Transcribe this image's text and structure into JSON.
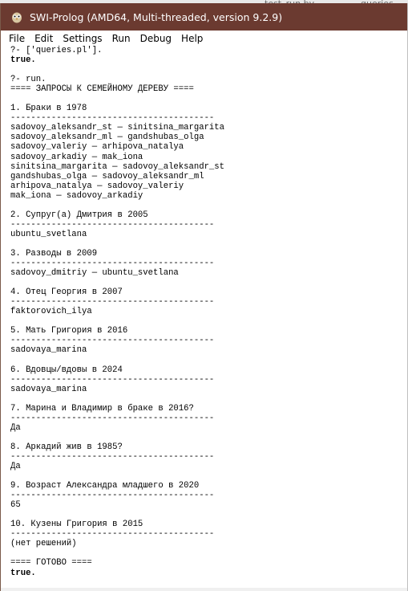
{
  "background": {
    "tab1": "test_run by",
    "tab2": "queries"
  },
  "window": {
    "title": "SWI-Prolog (AMD64, Multi-threaded, version 9.2.9)",
    "titlebar_color": "#6b3a30"
  },
  "menu": [
    "File",
    "Edit",
    "Settings",
    "Run",
    "Debug",
    "Help"
  ],
  "console_lines": [
    {
      "text": "?- ['queries.pl'].",
      "bold": false
    },
    {
      "text": "true.",
      "bold": true
    },
    {
      "text": "",
      "bold": false
    },
    {
      "text": "?- run.",
      "bold": false
    },
    {
      "text": "==== ЗАПРОСЫ К СЕМЕЙНОМУ ДЕРЕВУ ====",
      "bold": false
    },
    {
      "text": "",
      "bold": false
    },
    {
      "text": "1. Браки в 1978",
      "bold": false
    },
    {
      "text": "----------------------------------------",
      "bold": false
    },
    {
      "text": "sadovoy_aleksandr_st — sinitsina_margarita",
      "bold": false
    },
    {
      "text": "sadovoy_aleksandr_ml — gandshubas_olga",
      "bold": false
    },
    {
      "text": "sadovoy_valeriy — arhipova_natalya",
      "bold": false
    },
    {
      "text": "sadovoy_arkadiy — mak_iona",
      "bold": false
    },
    {
      "text": "sinitsina_margarita — sadovoy_aleksandr_st",
      "bold": false
    },
    {
      "text": "gandshubas_olga — sadovoy_aleksandr_ml",
      "bold": false
    },
    {
      "text": "arhipova_natalya — sadovoy_valeriy",
      "bold": false
    },
    {
      "text": "mak_iona — sadovoy_arkadiy",
      "bold": false
    },
    {
      "text": "",
      "bold": false
    },
    {
      "text": "2. Супруг(а) Дмитрия в 2005",
      "bold": false
    },
    {
      "text": "----------------------------------------",
      "bold": false
    },
    {
      "text": "ubuntu_svetlana",
      "bold": false
    },
    {
      "text": "",
      "bold": false
    },
    {
      "text": "3. Разводы в 2009",
      "bold": false
    },
    {
      "text": "----------------------------------------",
      "bold": false
    },
    {
      "text": "sadovoy_dmitriy — ubuntu_svetlana",
      "bold": false
    },
    {
      "text": "",
      "bold": false
    },
    {
      "text": "4. Отец Георгия в 2007",
      "bold": false
    },
    {
      "text": "----------------------------------------",
      "bold": false
    },
    {
      "text": "faktorovich_ilya",
      "bold": false
    },
    {
      "text": "",
      "bold": false
    },
    {
      "text": "5. Мать Григория в 2016",
      "bold": false
    },
    {
      "text": "----------------------------------------",
      "bold": false
    },
    {
      "text": "sadovaya_marina",
      "bold": false
    },
    {
      "text": "",
      "bold": false
    },
    {
      "text": "6. Вдовцы/вдовы в 2024",
      "bold": false
    },
    {
      "text": "----------------------------------------",
      "bold": false
    },
    {
      "text": "sadovaya_marina",
      "bold": false
    },
    {
      "text": "",
      "bold": false
    },
    {
      "text": "7. Марина и Владимир в браке в 2016?",
      "bold": false
    },
    {
      "text": "----------------------------------------",
      "bold": false
    },
    {
      "text": "Да",
      "bold": false
    },
    {
      "text": "",
      "bold": false
    },
    {
      "text": "8. Аркадий жив в 1985?",
      "bold": false
    },
    {
      "text": "----------------------------------------",
      "bold": false
    },
    {
      "text": "Да",
      "bold": false
    },
    {
      "text": "",
      "bold": false
    },
    {
      "text": "9. Возраст Александра младшего в 2020",
      "bold": false
    },
    {
      "text": "----------------------------------------",
      "bold": false
    },
    {
      "text": "65",
      "bold": false
    },
    {
      "text": "",
      "bold": false
    },
    {
      "text": "10. Кузены Григория в 2015",
      "bold": false
    },
    {
      "text": "----------------------------------------",
      "bold": false
    },
    {
      "text": "(нет решений)",
      "bold": false
    },
    {
      "text": "",
      "bold": false
    },
    {
      "text": "==== ГОТОВО ====",
      "bold": false
    },
    {
      "text": "true.",
      "bold": true
    }
  ]
}
